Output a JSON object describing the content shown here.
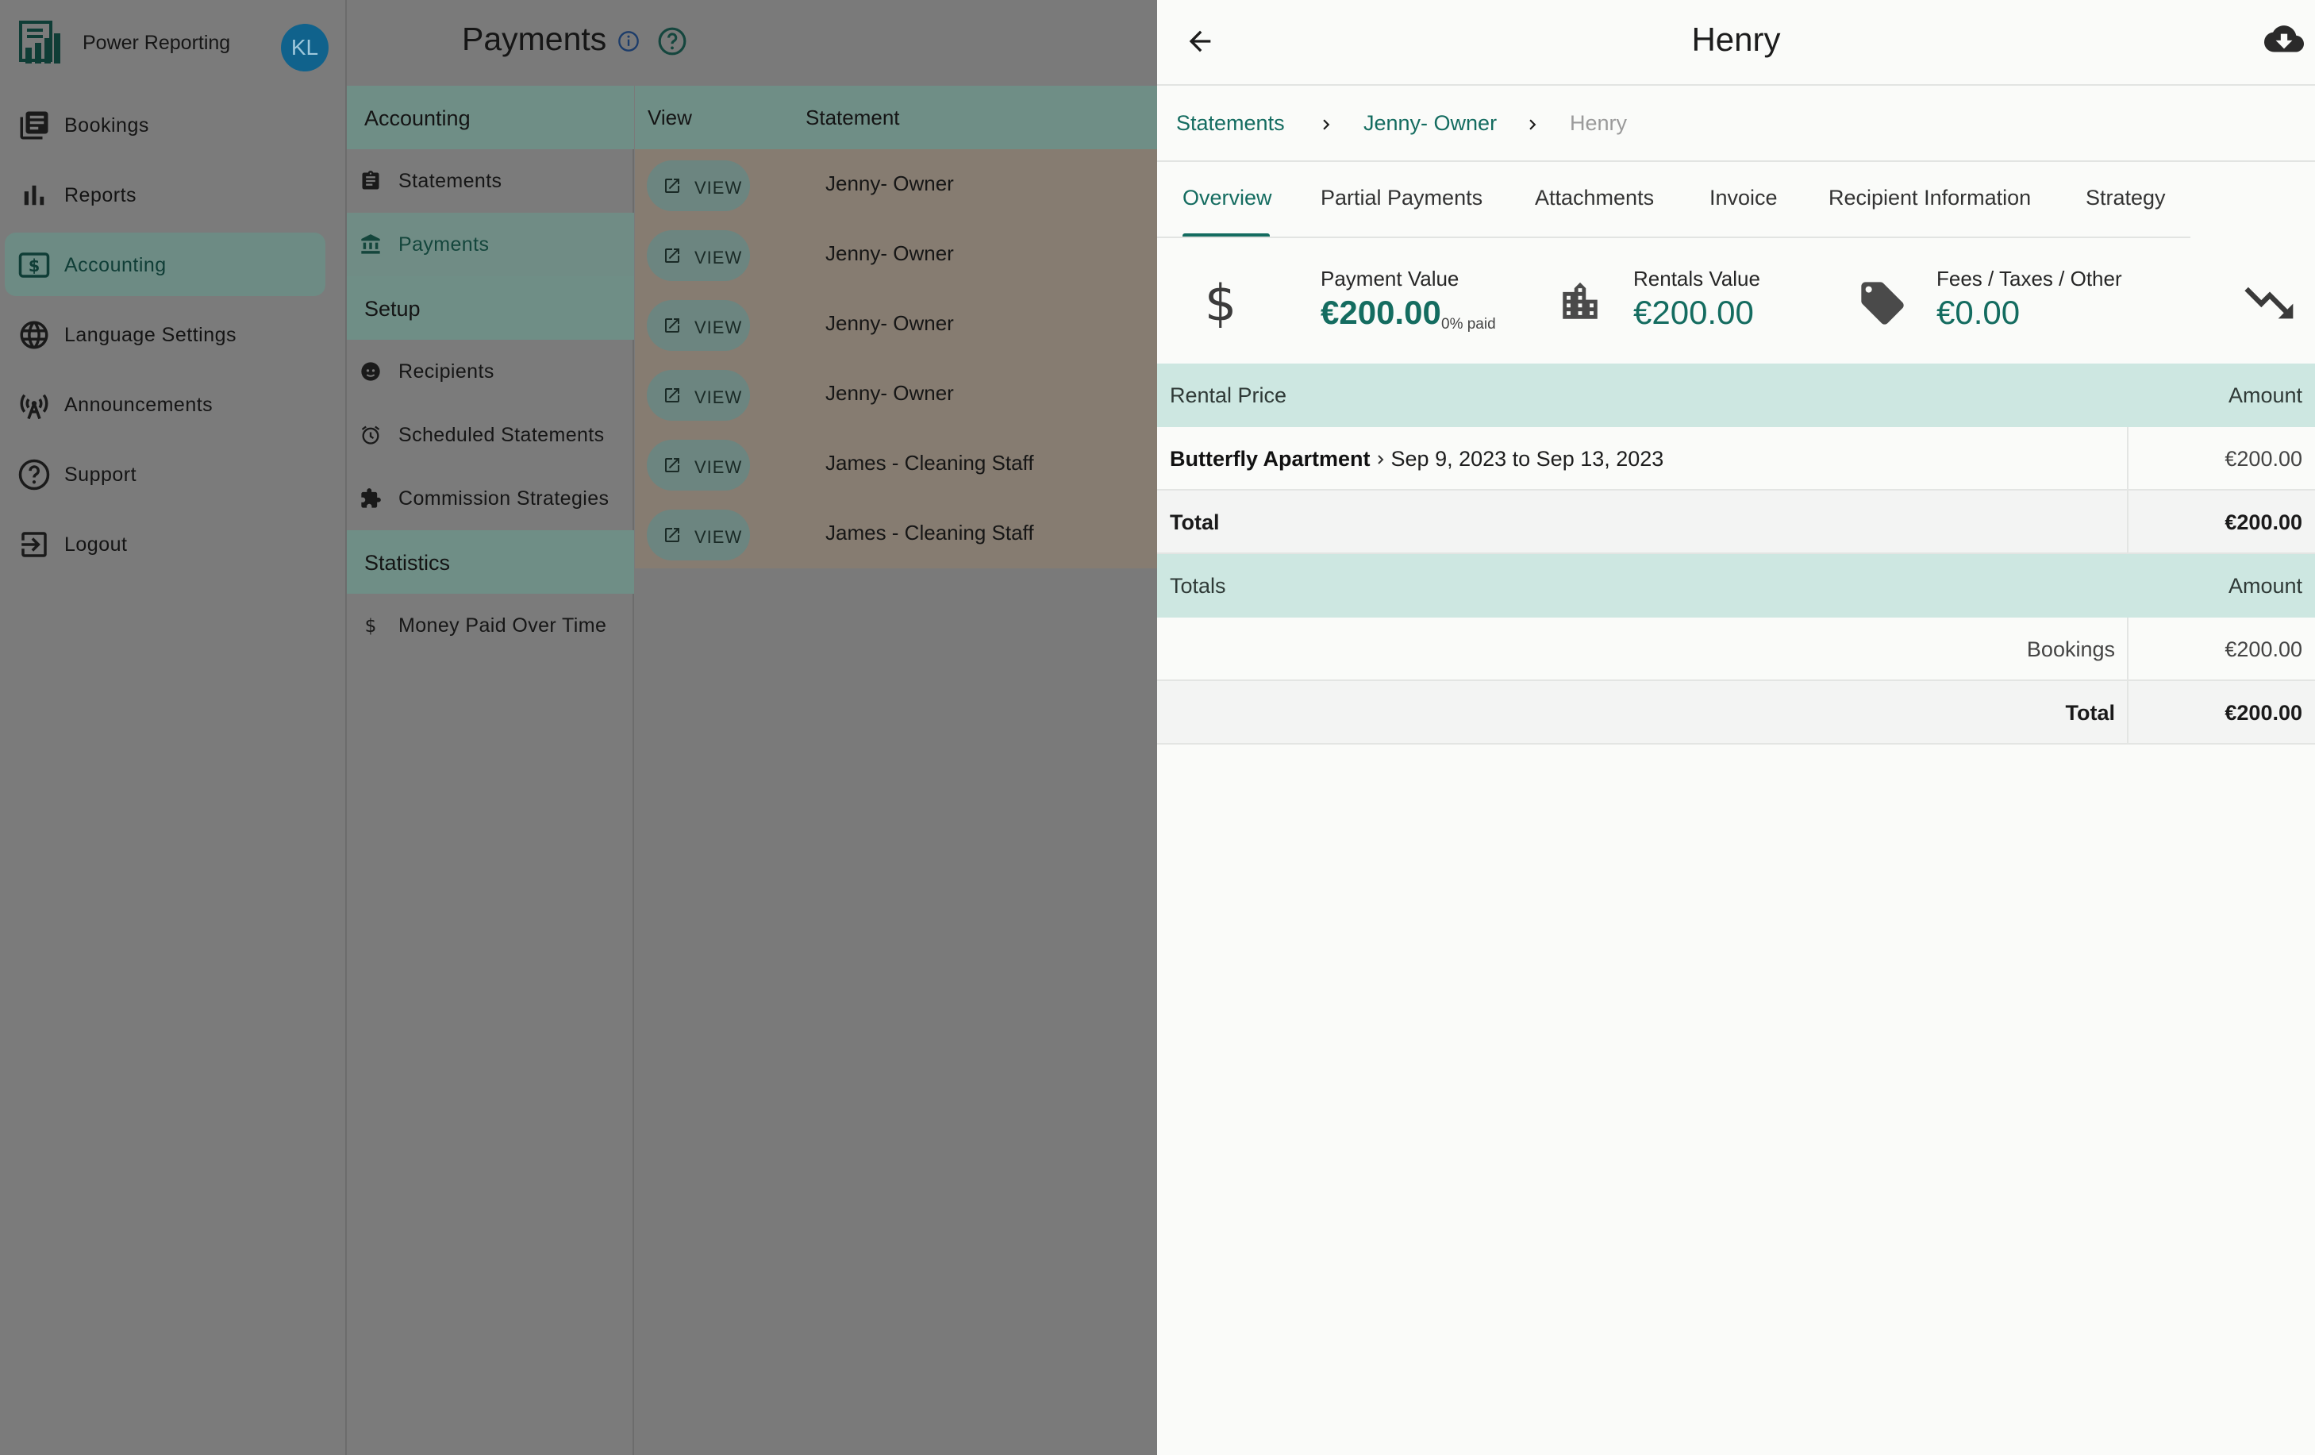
{
  "app": {
    "name": "Power Reporting",
    "avatar_initials": "KL"
  },
  "nav": {
    "items": [
      {
        "label": "Bookings",
        "icon": "bookings-icon"
      },
      {
        "label": "Reports",
        "icon": "bar-chart-icon"
      },
      {
        "label": "Accounting",
        "icon": "accounting-icon",
        "active": true
      },
      {
        "label": "Language Settings",
        "icon": "globe-icon"
      },
      {
        "label": "Announcements",
        "icon": "broadcast-icon"
      },
      {
        "label": "Support",
        "icon": "help-circle-icon"
      },
      {
        "label": "Logout",
        "icon": "logout-icon"
      }
    ]
  },
  "subnav": {
    "accounting_header": "Accounting",
    "statements": "Statements",
    "payments": "Payments",
    "setup_header": "Setup",
    "recipients": "Recipients",
    "scheduled_statements": "Scheduled Statements",
    "commission_strategies": "Commission Strategies",
    "statistics_header": "Statistics",
    "money_paid": "Money Paid Over Time"
  },
  "page": {
    "title": "Payments"
  },
  "table": {
    "col_view": "View",
    "col_statement": "Statement",
    "view_label": "VIEW",
    "rows": [
      {
        "statement": "Jenny- Owner"
      },
      {
        "statement": "Jenny- Owner"
      },
      {
        "statement": "Jenny- Owner"
      },
      {
        "statement": "Jenny- Owner"
      },
      {
        "statement": "James - Cleaning Staff"
      },
      {
        "statement": "James - Cleaning Staff"
      }
    ]
  },
  "drawer": {
    "title": "Henry",
    "breadcrumbs": [
      "Statements",
      "Jenny- Owner",
      "Henry"
    ],
    "tabs": [
      "Overview",
      "Partial Payments",
      "Attachments",
      "Invoice",
      "Recipient Information",
      "Strategy"
    ],
    "active_tab": "Overview",
    "stats": {
      "payment_label": "Payment Value",
      "payment_value": "€200.00",
      "payment_sub": "0% paid",
      "rentals_label": "Rentals Value",
      "rentals_value": "€200.00",
      "fees_label": "Fees / Taxes / Other",
      "fees_value": "€0.00"
    },
    "rental_table": {
      "header_left": "Rental Price",
      "header_right": "Amount",
      "property": "Butterfly Apartment",
      "dates": "Sep 9, 2023 to Sep 13, 2023",
      "amount": "€200.00",
      "total_label": "Total",
      "total_amount": "€200.00"
    },
    "totals_table": {
      "header_left": "Totals",
      "header_right": "Amount",
      "bookings_label": "Bookings",
      "bookings_amount": "€200.00",
      "total_label": "Total",
      "total_amount": "€200.00"
    }
  },
  "colors": {
    "accent": "#146c60",
    "header_band": "#cde7e1",
    "avatar": "#10628c"
  }
}
